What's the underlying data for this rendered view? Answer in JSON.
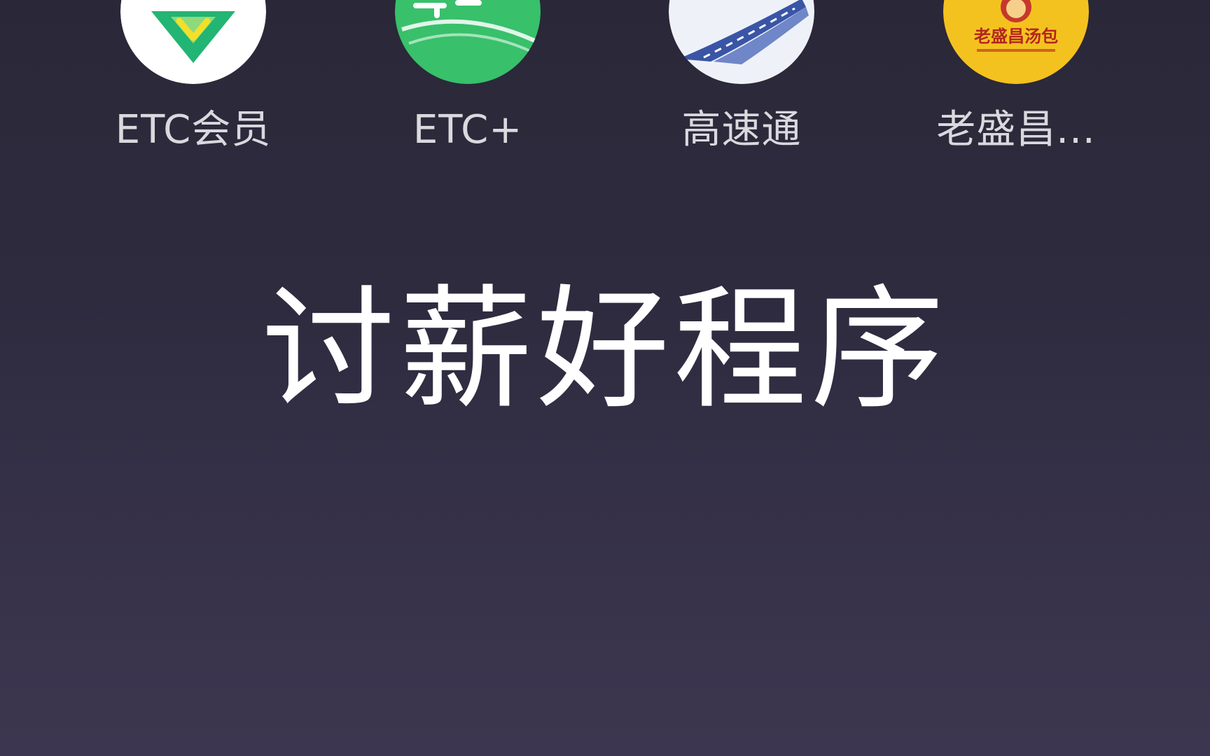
{
  "apps": [
    {
      "label": "ETC会员",
      "icon": "etc-member-icon",
      "color": "#2bbf7a"
    },
    {
      "label": "ETC+",
      "icon": "etc-plus-icon",
      "color": "#3cc070"
    },
    {
      "label": "高速通",
      "icon": "highway-icon",
      "color": "#2f4fa8"
    },
    {
      "label": "老盛昌...",
      "icon": "laoshengchang-icon",
      "color": "#f3c31e",
      "logo_text": "老盛昌汤包"
    }
  ],
  "headline": "讨薪好程序"
}
